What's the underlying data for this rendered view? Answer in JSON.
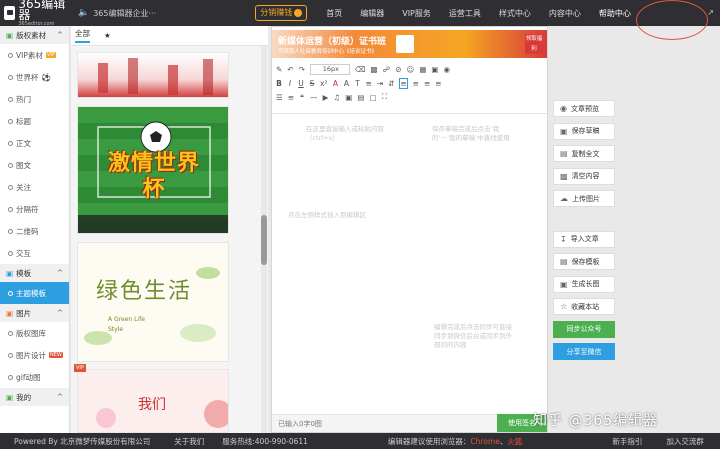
{
  "topbar": {
    "logo_text": "365编辑器",
    "logo_sub": "365editor.com",
    "site_title": "365编辑器企业···",
    "earn_label": "分销赚钱",
    "nav": [
      "首页",
      "编辑器",
      "VIP服务",
      "运营工具",
      "样式中心",
      "内容中心",
      "帮助中心"
    ]
  },
  "sidebar": {
    "sections": [
      {
        "title": "版权素材",
        "items": [
          "VIP素材",
          "世界杯",
          "热门",
          "标题",
          "正文",
          "图文",
          "关注",
          "分隔符",
          "二维码",
          "交互"
        ]
      },
      {
        "title": "模板",
        "items": [
          "主题模板"
        ]
      },
      {
        "title": "图片",
        "items": [
          "版权图库",
          "图片设计",
          "gif动图"
        ]
      },
      {
        "title": "我的",
        "items": []
      }
    ],
    "vip_tag": "VIP",
    "new_tag": "NEW"
  },
  "materials": {
    "tabs": [
      "全部"
    ],
    "card2_title": "激情世界杯",
    "card3_title": "绿色生活",
    "card3_sub": "A Green Life Style",
    "card4_title": "我们"
  },
  "editor": {
    "banner_title": "新媒体运营（初级）证书班",
    "banner_sub": "可获取人社部教育培训中心《培训证书》",
    "banner_btn": "领取福利",
    "font_size": "16px",
    "hint1": "在这里直接输入或粘贴内容（ctrl+v）",
    "hint2": "保存摹稿完成后点击‘我的’－‘我的摹稿’中查找使用",
    "hint3": "点击左侧样式插入到编辑区",
    "hint4": "编辑完成后点击同步可直接同步到微信后台或同步到外部同的内容",
    "status": "已输入0字0图",
    "use_btn": "使用签名"
  },
  "actions": [
    "文章预览",
    "保存草稿",
    "复制全文",
    "清空内容",
    "上传图片",
    "导入文章",
    "保存模板",
    "生成长图",
    "收藏本站",
    "同步公众号",
    "分享至微信"
  ],
  "footer": {
    "powered": "Powered By 北京微梦传媒股份有限公司",
    "about": "关于我们",
    "hotline": "服务热线:400-990-0611",
    "browser_label": "编辑器建议使用浏览器：",
    "chrome": "Chrome",
    "sep": "、",
    "firefox": "火狐",
    "guide": "新手指引",
    "group": "加入交流群"
  },
  "watermark": "知乎 @365编辑器"
}
